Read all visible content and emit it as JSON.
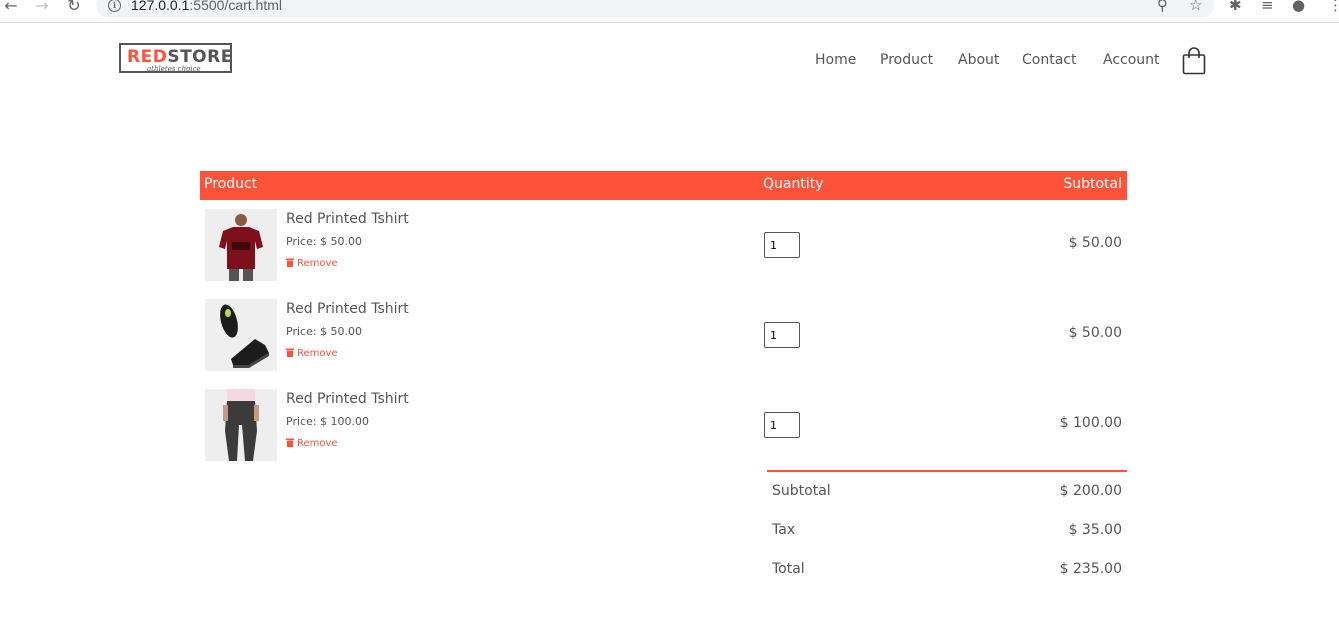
{
  "browser": {
    "url_host": "127.0.0.1",
    "url_path": ":5500/cart.html"
  },
  "logo": {
    "brand_red": "RED",
    "brand_dark": "STORE",
    "tagline": "athletes choice"
  },
  "nav": {
    "items": [
      "Home",
      "Product",
      "About",
      "Contact",
      "Account"
    ]
  },
  "table": {
    "headers": {
      "product": "Product",
      "quantity": "Quantity",
      "subtotal": "Subtotal"
    },
    "rows": [
      {
        "name": "Red Printed Tshirt",
        "price": "Price: $ 50.00",
        "remove": "Remove",
        "qty": "1",
        "subtotal": "$ 50.00",
        "image": "red-tshirt"
      },
      {
        "name": "Red Printed Tshirt",
        "price": "Price: $ 50.00",
        "remove": "Remove",
        "qty": "1",
        "subtotal": "$ 50.00",
        "image": "black-shoes"
      },
      {
        "name": "Red Printed Tshirt",
        "price": "Price: $ 100.00",
        "remove": "Remove",
        "qty": "1",
        "subtotal": "$ 100.00",
        "image": "grey-joggers"
      }
    ]
  },
  "totals": {
    "subtotal_label": "Subtotal",
    "subtotal_value": "$ 200.00",
    "tax_label": "Tax",
    "tax_value": "$ 35.00",
    "total_label": "Total",
    "total_value": "$ 235.00"
  },
  "colors": {
    "accent": "#ff523b",
    "text": "#555555"
  }
}
